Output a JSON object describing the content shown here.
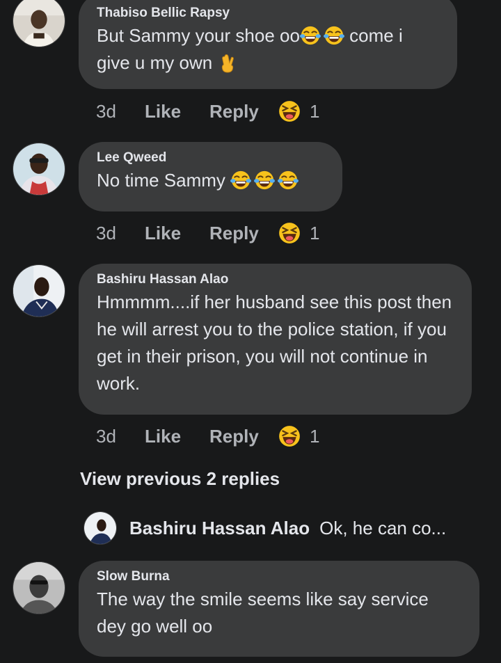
{
  "comments": [
    {
      "author": "Thabiso Bellic Rapsy",
      "text_line1": "But Sammy your shoe oo",
      "text_line1_after": " come i",
      "text_line2": "give u my own",
      "time": "3d",
      "like": "Like",
      "reply": "Reply",
      "reaction_count": "1"
    },
    {
      "author": "Lee Qweed",
      "text": "No time Sammy ",
      "time": "3d",
      "like": "Like",
      "reply": "Reply",
      "reaction_count": "1"
    },
    {
      "author": "Bashiru Hassan Alao",
      "text": "Hmmmm....if her husband see this post then he will arrest you to the police station, if you get in their prison, you will not continue in work.",
      "time": "3d",
      "like": "Like",
      "reply": "Reply",
      "reaction_count": "1"
    },
    {
      "author": "Slow Burna",
      "text": "The way the smile seems like say service dey go well oo"
    }
  ],
  "view_previous": "View previous 2 replies",
  "reply_preview": {
    "author": "Bashiru Hassan Alao",
    "text": "Ok, he can co..."
  },
  "icons": {
    "laugh_cry": "face-with-tears-of-joy-icon",
    "crossed_fingers": "crossed-fingers-icon",
    "laughing_reaction": "haha-reaction-icon"
  },
  "colors": {
    "background": "#18191a",
    "bubble": "#3a3b3c",
    "primary_text": "#e4e6eb",
    "secondary_text": "#b0b3b8"
  }
}
